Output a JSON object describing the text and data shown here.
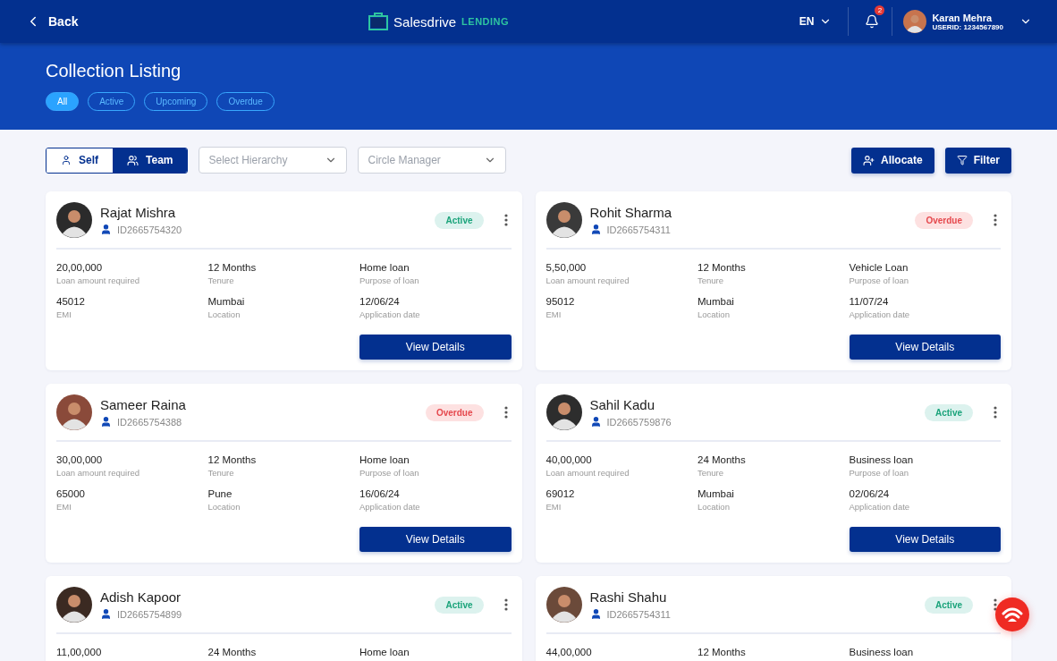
{
  "header": {
    "back": "Back",
    "logo_main": "Salesdrive",
    "logo_sub": "LENDING",
    "language": "EN",
    "notifications": "2",
    "user": {
      "name": "Karan Mehra",
      "userid": "USERID: 1234567890"
    }
  },
  "page": {
    "title": "Collection Listing",
    "chips": [
      {
        "label": "All",
        "selected": true
      },
      {
        "label": "Active",
        "selected": false
      },
      {
        "label": "Upcoming",
        "selected": false
      },
      {
        "label": "Overdue",
        "selected": false
      }
    ]
  },
  "toolbar": {
    "toggle": [
      {
        "label": "Self",
        "selected": false
      },
      {
        "label": "Team",
        "selected": true
      }
    ],
    "dropdowns": [
      {
        "placeholder": "Select Hierarchy"
      },
      {
        "placeholder": "Circle Manager"
      }
    ],
    "buttons": [
      {
        "label": "Allocate",
        "kind": "allocate"
      },
      {
        "label": "Filter",
        "kind": "filter"
      }
    ]
  },
  "cards": [
    {
      "name": "Rajat Mishra",
      "id": "ID2665754320",
      "status": {
        "label": "Active",
        "kind": "active"
      },
      "fields": [
        {
          "value": "20,00,000",
          "label": "Loan amount required"
        },
        {
          "value": "12 Months",
          "label": "Tenure"
        },
        {
          "value": "Home loan",
          "label": "Purpose of loan"
        },
        {
          "value": "45012",
          "label": "EMI"
        },
        {
          "value": "Mumbai",
          "label": "Location"
        },
        {
          "value": "12/06/24",
          "label": "Application date"
        }
      ],
      "button": "View Details"
    },
    {
      "name": "Rohit Sharma",
      "id": "ID2665754311",
      "status": {
        "label": "Overdue",
        "kind": "overdue"
      },
      "fields": [
        {
          "value": "5,50,000",
          "label": "Loan amount required"
        },
        {
          "value": "12 Months",
          "label": "Tenure"
        },
        {
          "value": "Vehicle  Loan",
          "label": "Purpose of loan"
        },
        {
          "value": "95012",
          "label": "EMI"
        },
        {
          "value": "Mumbai",
          "label": "Location"
        },
        {
          "value": "11/07/24",
          "label": "Application date"
        }
      ],
      "button": "View Details"
    },
    {
      "name": "Sameer Raina",
      "id": "ID2665754388",
      "status": {
        "label": "Overdue",
        "kind": "overdue"
      },
      "fields": [
        {
          "value": "30,00,000",
          "label": "Loan amount required"
        },
        {
          "value": "12 Months",
          "label": "Tenure"
        },
        {
          "value": "Home loan",
          "label": "Purpose of loan"
        },
        {
          "value": "65000",
          "label": "EMI"
        },
        {
          "value": "Pune",
          "label": "Location"
        },
        {
          "value": "16/06/24",
          "label": "Application date"
        }
      ],
      "button": "View Details"
    },
    {
      "name": "Sahil Kadu",
      "id": "ID2665759876",
      "status": {
        "label": "Active",
        "kind": "active"
      },
      "fields": [
        {
          "value": "40,00,000",
          "label": "Loan amount required"
        },
        {
          "value": "24 Months",
          "label": "Tenure"
        },
        {
          "value": "Business loan",
          "label": "Purpose of loan"
        },
        {
          "value": "69012",
          "label": "EMI"
        },
        {
          "value": "Mumbai",
          "label": "Location"
        },
        {
          "value": "02/06/24",
          "label": "Application date"
        }
      ],
      "button": "View Details"
    },
    {
      "name": "Adish Kapoor",
      "id": "ID2665754899",
      "status": {
        "label": "Active",
        "kind": "active"
      },
      "fields": [
        {
          "value": "11,00,000"
        },
        {
          "value": "24 Months"
        },
        {
          "value": "Home loan"
        }
      ]
    },
    {
      "name": "Rashi Shahu",
      "id": "ID2665754311",
      "status": {
        "label": "Active",
        "kind": "active"
      },
      "fields": [
        {
          "value": "44,00,000"
        },
        {
          "value": "12 Months"
        },
        {
          "value": "Business loan"
        }
      ]
    }
  ]
}
